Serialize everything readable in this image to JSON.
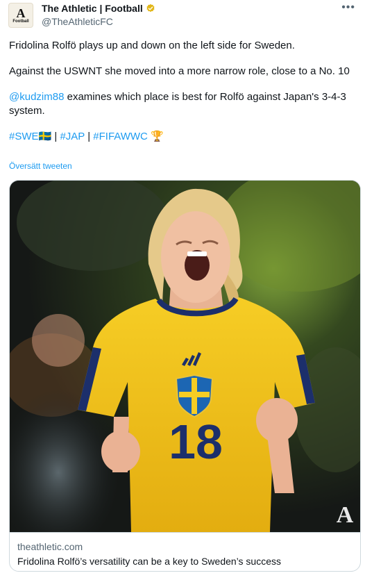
{
  "account": {
    "name": "The Athletic | Football",
    "handle": "@TheAthleticFC",
    "avatar_letter": "A",
    "avatar_sub": "Football",
    "verified_color": "#e2b719"
  },
  "tweet": {
    "line1": "Fridolina Rolfö plays up and down on the left side for Sweden.",
    "line2": "Against the USWNT she moved into a more narrow role, close to a No. 10",
    "mention": "@kudzim88",
    "line3_rest": " examines which place is best for Rolfö against Japan's 3-4-3 system.",
    "hashtag_swe": "#SWE",
    "flag_swe": "🇸🇪",
    "sep1": " | ",
    "hashtag_jap": "#JAP",
    "sep2": " | ",
    "hashtag_wwc": "#FIFAWWC",
    "trophy": "🏆",
    "translate_label": "Översätt tweeten"
  },
  "card": {
    "shirt_number": "18",
    "domain": "theathletic.com",
    "title": "Fridolina Rolfö’s versatility can be a key to Sweden’s success",
    "watermark": "A"
  },
  "colors": {
    "link": "#1d9bf0",
    "shirt_yellow": "#f2c31c",
    "shirt_blue": "#1c2f6b"
  },
  "icons": {
    "more": "more-horizontal-icon",
    "verified": "verified-badge-icon"
  }
}
